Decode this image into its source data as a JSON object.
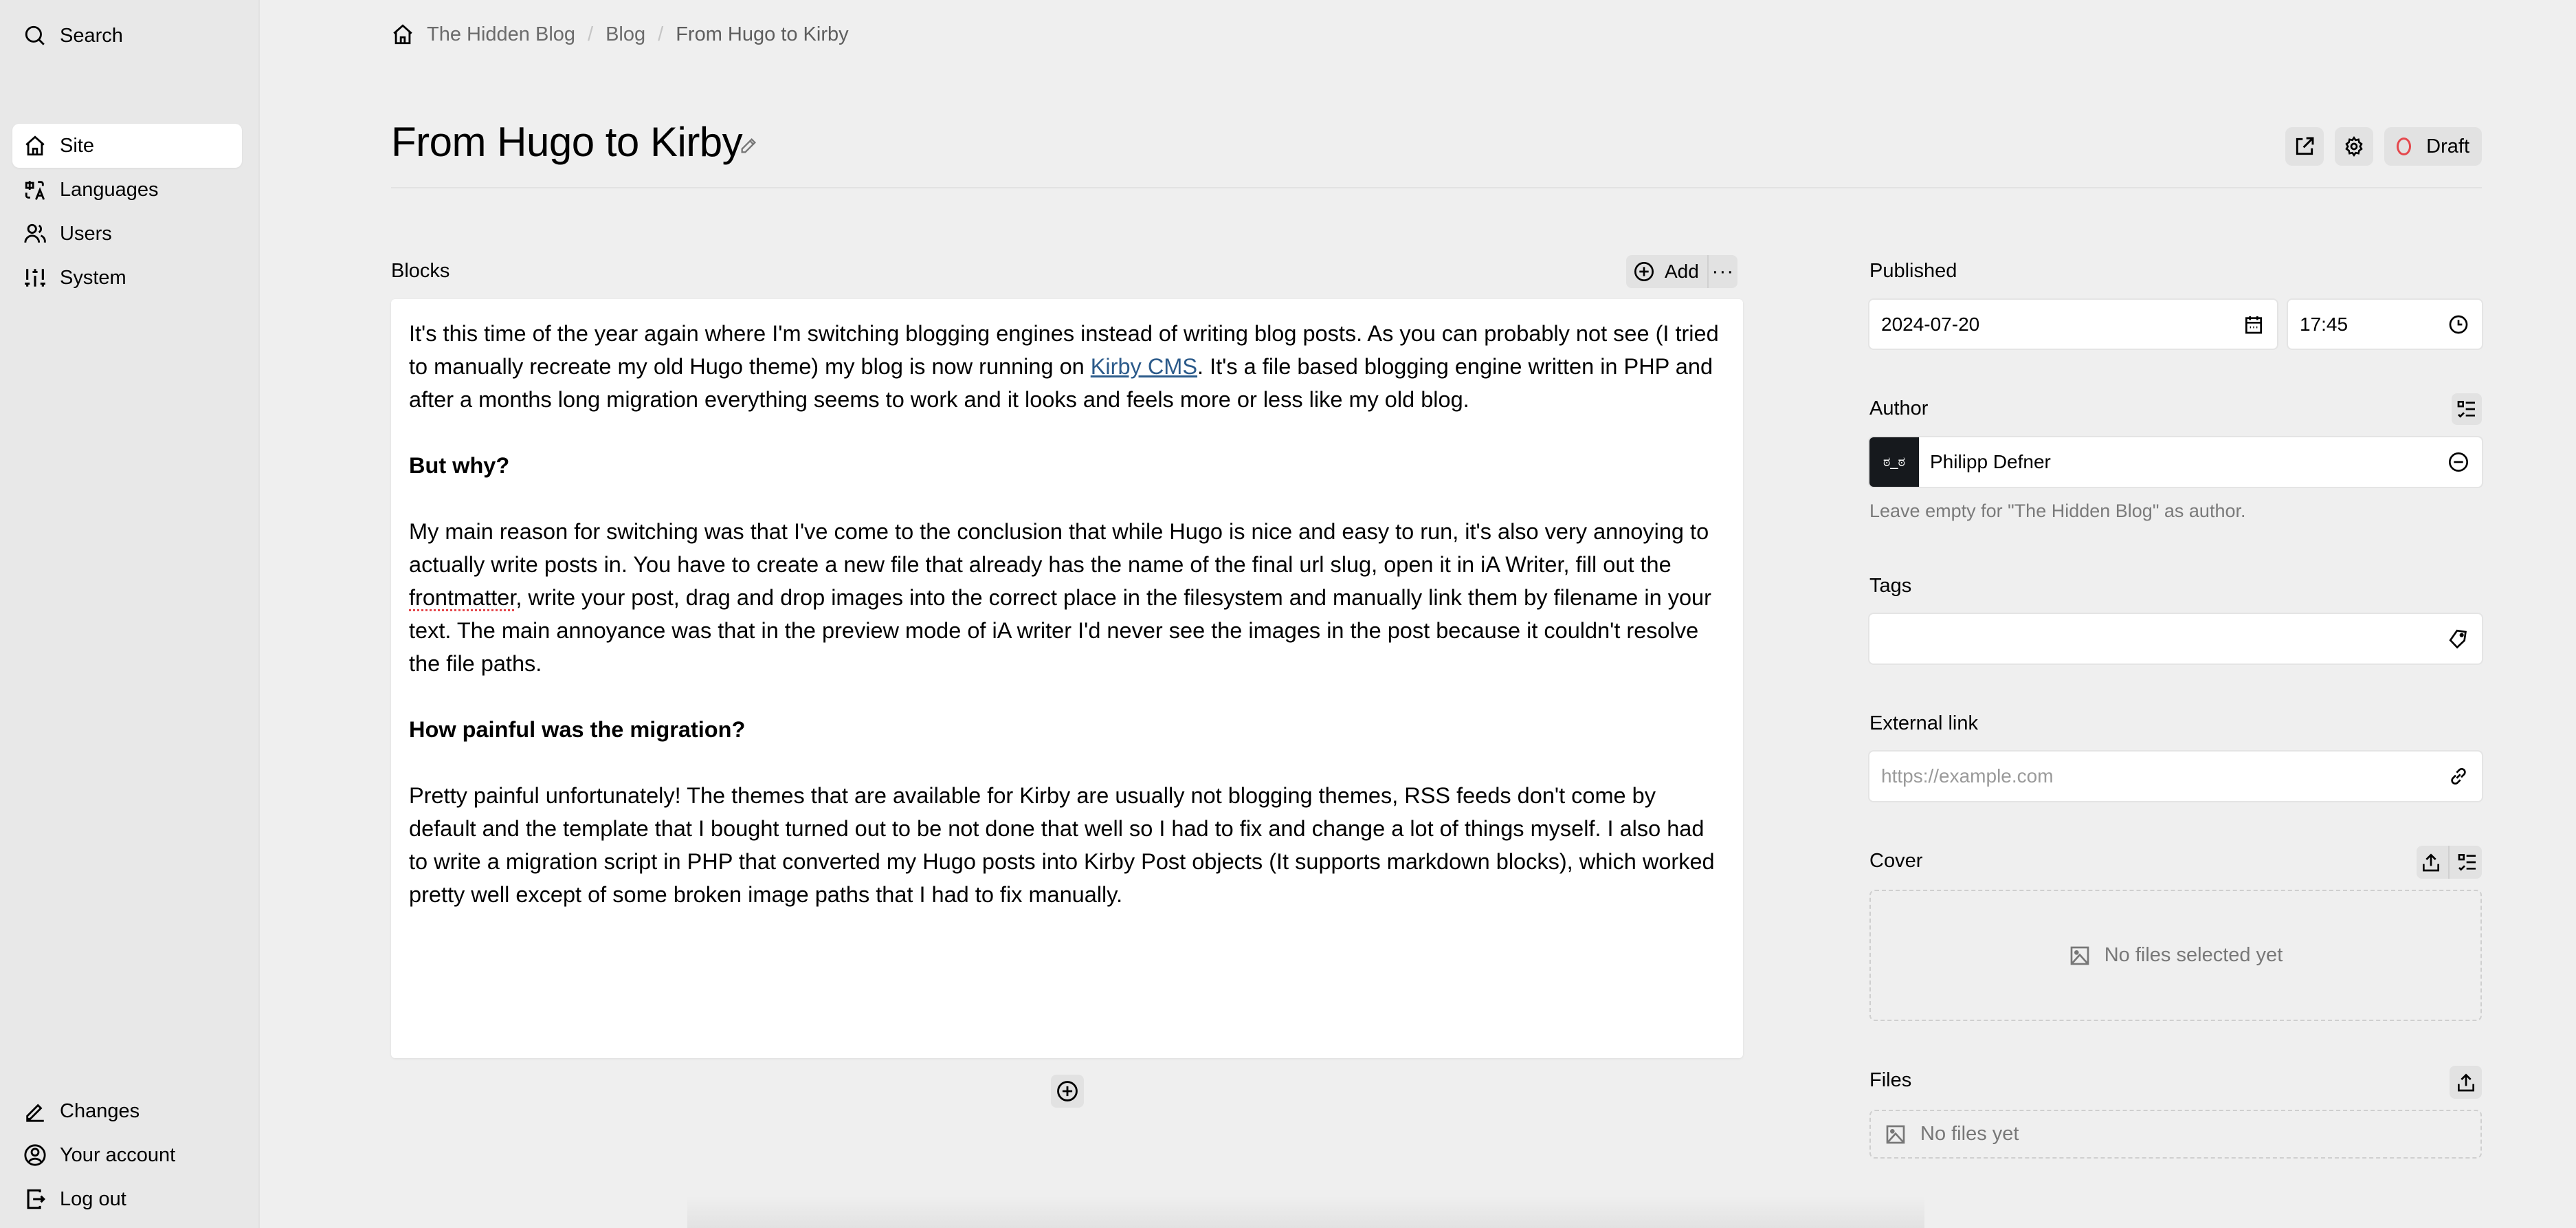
{
  "sidebar": {
    "search": "Search",
    "items": [
      {
        "label": "Site",
        "icon": "home-icon",
        "active": true
      },
      {
        "label": "Languages",
        "icon": "translate-icon"
      },
      {
        "label": "Users",
        "icon": "users-icon"
      },
      {
        "label": "System",
        "icon": "sliders-icon"
      }
    ],
    "bottom": [
      {
        "label": "Changes",
        "icon": "pencil-icon"
      },
      {
        "label": "Your account",
        "icon": "account-icon"
      },
      {
        "label": "Log out",
        "icon": "logout-icon"
      }
    ]
  },
  "breadcrumb": [
    "The Hidden Blog",
    "Blog",
    "From Hugo to Kirby"
  ],
  "breadcrumb_separator": "/",
  "page": {
    "title": "From Hugo to Kirby",
    "status": "Draft",
    "status_color": "#e5484d"
  },
  "blocks": {
    "label": "Blocks",
    "add_label": "Add",
    "more_label": "···",
    "p1_before_link": "It's this time of the year again where I'm switching blogging engines instead of writing blog posts. As you can probably not see (I tried to manually recreate my old Hugo theme) my blog is now running on ",
    "p1_link": "Kirby CMS",
    "p1_after_link": ". It's a file based blogging engine written in PHP and after a months long migration everything seems to work and it looks and feels more or less like my old blog.",
    "h1": "But why?",
    "p2_before": "My main reason for switching was that I've come to the conclusion that while Hugo is nice and easy to run, it's also very annoying to actually write posts in. You have to create a new file that already has the name of the final url slug, open it in iA Writer, fill out the ",
    "p2_spell": "frontmatter",
    "p2_after": ", write your post, drag and drop images into the correct place in the filesystem and manually link them by filename in your text. The main annoyance was that in the preview mode of iA writer I'd never see the images in the post because it couldn't resolve the file paths.",
    "h2": "How painful was the migration?",
    "p3": "Pretty painful unfortunately! The themes that are available for Kirby are usually not blogging themes, RSS feeds don't come by default and the template that I bought turned out to be not done that well so I had to fix and change a lot of things myself. I also had to write a migration script in PHP that converted my Hugo posts into Kirby Post objects (It supports markdown blocks), which worked pretty well except of some broken image paths that I had to fix manually."
  },
  "fields": {
    "published": {
      "label": "Published",
      "date": "2024-07-20",
      "time": "17:45"
    },
    "author": {
      "label": "Author",
      "avatar_text": "ಠ_ಠ",
      "name": "Philipp Defner",
      "help": "Leave empty for \"The Hidden Blog\" as author."
    },
    "tags": {
      "label": "Tags",
      "value": ""
    },
    "external_link": {
      "label": "External link",
      "placeholder": "https://example.com"
    },
    "cover": {
      "label": "Cover",
      "empty": "No files selected yet"
    },
    "files": {
      "label": "Files",
      "empty": "No files yet"
    }
  }
}
